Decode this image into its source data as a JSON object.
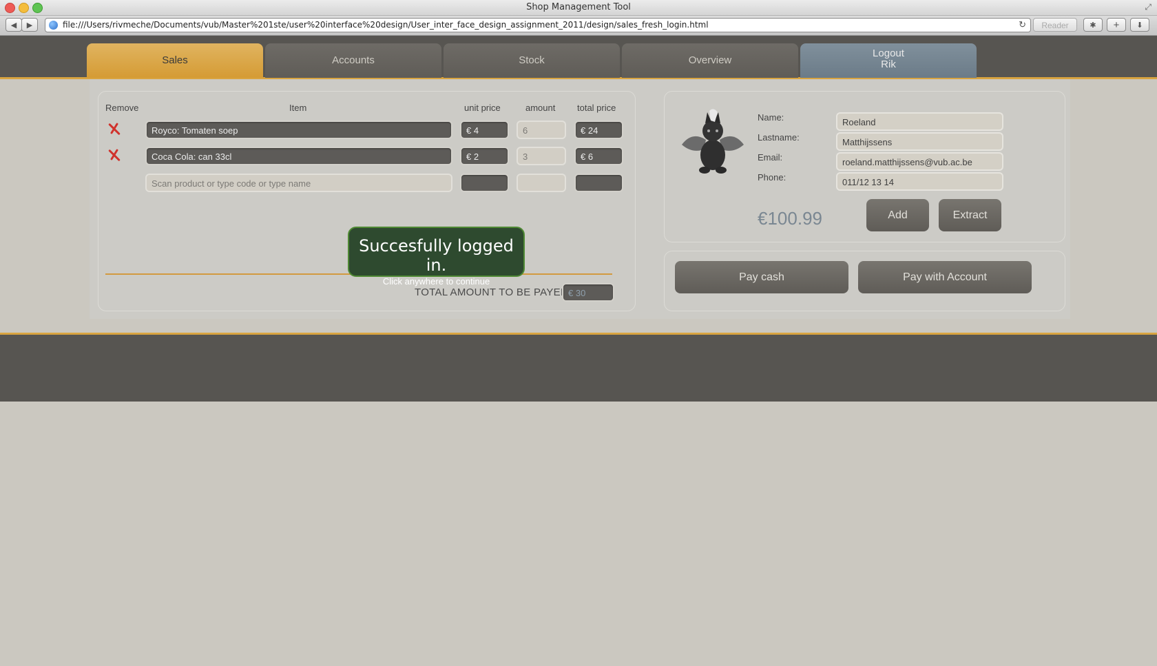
{
  "window": {
    "title": "Shop Management Tool",
    "url": "file:///Users/rivmeche/Documents/vub/Master%201ste/user%20interface%20design/User_inter_face_design_assignment_2011/design/sales_fresh_login.html",
    "reader_label": "Reader"
  },
  "tabs": [
    {
      "label": "Sales"
    },
    {
      "label": "Accounts"
    },
    {
      "label": "Stock"
    },
    {
      "label": "Overview"
    }
  ],
  "logout": {
    "line1": "Logout",
    "line2": "Rik"
  },
  "sales": {
    "headers": {
      "remove": "Remove",
      "item": "Item",
      "unit_price": "unit price",
      "amount": "amount",
      "total_price": "total price"
    },
    "rows": [
      {
        "item": "Royco: Tomaten soep",
        "unit_price": "€ 4",
        "amount": "6",
        "total_price": "€ 24"
      },
      {
        "item": "Coca Cola: can 33cl",
        "unit_price": "€ 2",
        "amount": "3",
        "total_price": "€ 6"
      }
    ],
    "new_row_placeholder": "Scan product or type code or type name",
    "total_label": "TOTAL AMOUNT TO BE PAYED",
    "total_value": "€ 30"
  },
  "toast": {
    "title": "Succesfully logged in.",
    "subtitle": "Click anywhere to continue"
  },
  "customer": {
    "labels": {
      "name": "Name:",
      "lastname": "Lastname:",
      "email": "Email:",
      "phone": "Phone:"
    },
    "name": "Roeland",
    "lastname": "Matthijssens",
    "email": "roeland.matthijssens@vub.ac.be",
    "phone": "011/12 13 14",
    "balance": "€100.99",
    "add_label": "Add",
    "extract_label": "Extract"
  },
  "payment": {
    "cash_label": "Pay cash",
    "account_label": "Pay with Account"
  },
  "colors": {
    "accent": "#d9a440",
    "header": "#575551",
    "toast": "#2e4a2f",
    "remove": "#d0322c"
  }
}
